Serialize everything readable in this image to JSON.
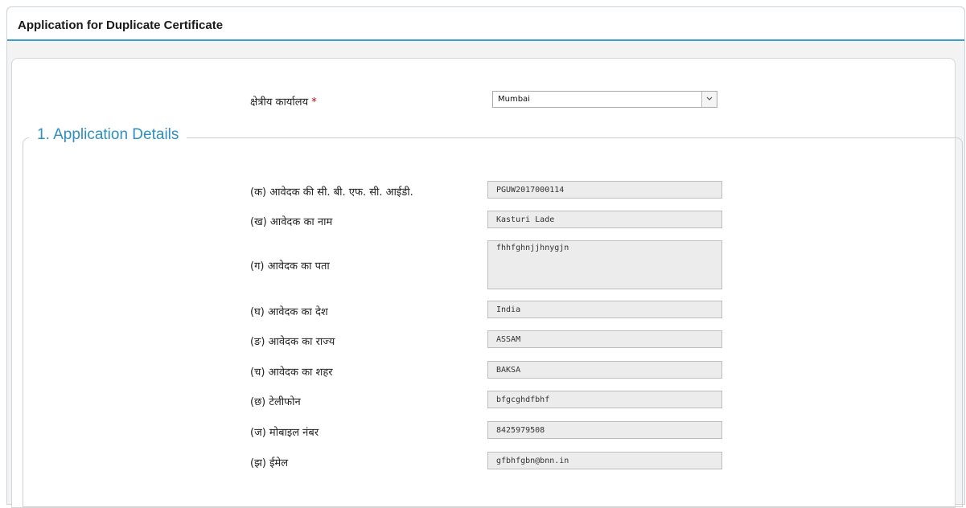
{
  "header": {
    "title": "Application for Duplicate Certificate"
  },
  "regional_office": {
    "label": "क्षेत्रीय कार्यालय",
    "required_mark": "*",
    "selected": "Mumbai"
  },
  "section": {
    "legend": "1. Application Details"
  },
  "fields": [
    {
      "label": "(क) आवेदक की सी. बी. एफ. सी. आईडी.",
      "value": "PGUW2017000114"
    },
    {
      "label": "(ख) आवेदक का नाम",
      "value": "Kasturi Lade"
    },
    {
      "label": "(ग) आवेदक का पता",
      "value": "fhhfghnjjhnygjn"
    },
    {
      "label": "(घ) आवेदक का देश",
      "value": "India"
    },
    {
      "label": "(ङ) आवेदक का राज्य",
      "value": "ASSAM"
    },
    {
      "label": "(च) आवेदक का शहर",
      "value": "BAKSA"
    },
    {
      "label": "(छ) टेलीफोन",
      "value": "bfgcghdfbhf"
    },
    {
      "label": "(ज) मोबाइल नंबर",
      "value": "8425979508"
    },
    {
      "label": "(झ) ईमेल",
      "value": "gfbhfgbn@bnn.in"
    }
  ]
}
